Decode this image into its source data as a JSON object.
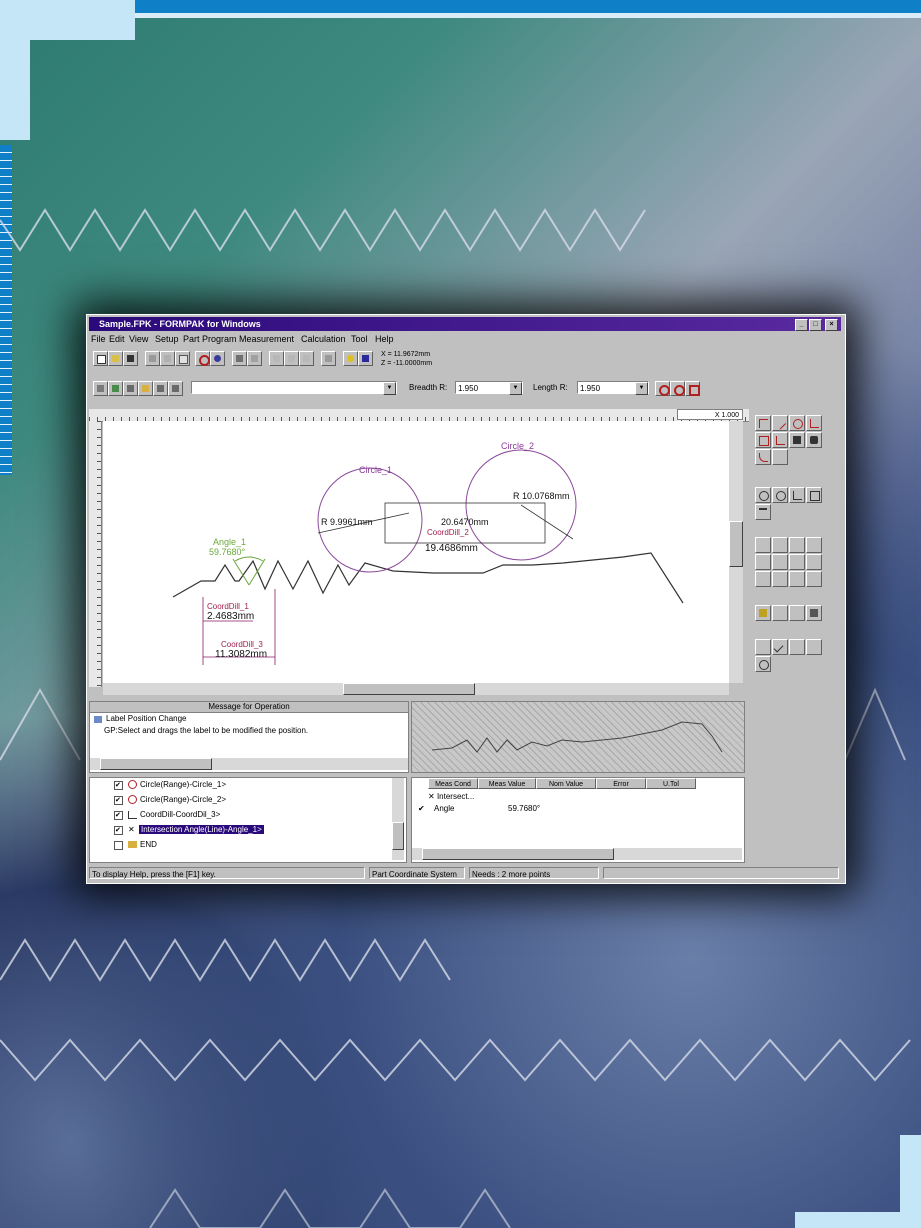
{
  "window": {
    "title": "Sample.FPK - FORMPAK for Windows",
    "controls": [
      "_",
      "□",
      "×"
    ]
  },
  "menu": [
    "File",
    "Edit",
    "View",
    "Setup",
    "Part Program",
    "Measurement",
    "Calculation",
    "Tool",
    "Help"
  ],
  "coords": {
    "x": "X = 11.9672mm",
    "z": "Z = -11.0000mm"
  },
  "toolbar2": {
    "combo_value": "",
    "breadth_label": "Breadth R:",
    "breadth_value": "1.950",
    "length_label": "Length R:",
    "length_value": "1.950"
  },
  "ruler_readout": "X 1.000",
  "canvas": {
    "labels": {
      "circle1": "Circle_1",
      "circle2": "Circle_2",
      "r1": "R 9.9961mm",
      "r2": "R 10.0768mm",
      "d1": "20.6470mm",
      "coorddill2": "CoordDill_2",
      "d2": "19.4686mm",
      "angle_name": "Angle_1",
      "angle_value": "59.7680°",
      "coorddill1": "CoordDill_1",
      "d3": "2.4683mm",
      "coorddill3": "CoordDill_3",
      "d4": "11.3082mm"
    }
  },
  "message_panel": {
    "header": "Message for Operation",
    "line1": "Label Position Change",
    "line2": "GP:Select and drags the label to be modified the position."
  },
  "tree": {
    "items": [
      "Circle(Range)-Circle_1>",
      "Circle(Range)-Circle_2>",
      "CoordDill-CoordDil_3>",
      "Intersection Angle(Line)-Angle_1>",
      "END"
    ]
  },
  "results": {
    "columns": [
      "Meas Cond",
      "Meas Value",
      "Nom Value",
      "Error",
      "U.Tol"
    ],
    "rows": [
      {
        "name": "Intersect...",
        "value": ""
      },
      {
        "name": "Angle",
        "value": "59.7680°"
      }
    ]
  },
  "status": {
    "help": "To display Help, press the [F1] key.",
    "system": "Part Coordinate System",
    "needs": "Needs : 2 more points"
  },
  "colors": {
    "titlebar": "#3a1288",
    "dimension": "#8a1a6a",
    "angle": "#6aa83a",
    "accent_blue": "#0f80c8"
  }
}
